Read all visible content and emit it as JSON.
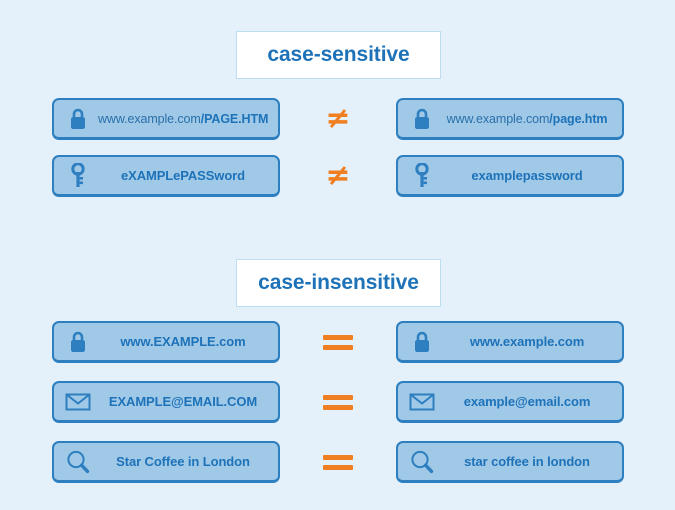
{
  "page": {
    "background_color": "#e4f1fa",
    "accent_blue": "#1d72b8",
    "box_fill": "#a0c9e8",
    "box_border": "#2e7fc0",
    "operator_orange": "#f07f22"
  },
  "sections": [
    {
      "title": "case-sensitive",
      "operator": "≠",
      "operator_name": "not-equal-sign",
      "rows": [
        {
          "operator": "≠",
          "left": {
            "icon": "lock-icon",
            "type": "url",
            "prefix": "www.example.com",
            "path": "/PAGE.HTM",
            "text": "www.example.com/PAGE.HTM"
          },
          "right": {
            "icon": "lock-icon",
            "type": "url",
            "prefix": "www.example.com",
            "path": "/page.htm",
            "text": "www.example.com/page.htm"
          }
        },
        {
          "operator": "≠",
          "left": {
            "icon": "key-icon",
            "type": "plain",
            "text": "eXAMPLePASSword"
          },
          "right": {
            "icon": "key-icon",
            "type": "plain",
            "text": "examplepassword"
          }
        }
      ]
    },
    {
      "title": "case-insensitive",
      "operator": "=",
      "operator_name": "equals-sign",
      "rows": [
        {
          "operator": "=",
          "left": {
            "icon": "lock-icon",
            "type": "plain",
            "text": "www.EXAMPLE.com"
          },
          "right": {
            "icon": "lock-icon",
            "type": "plain",
            "text": "www.example.com"
          }
        },
        {
          "operator": "=",
          "left": {
            "icon": "envelope-icon",
            "type": "plain",
            "text": "EXAMPLE@EMAIL.COM"
          },
          "right": {
            "icon": "envelope-icon",
            "type": "plain",
            "text": "example@email.com"
          }
        },
        {
          "operator": "=",
          "left": {
            "icon": "search-icon",
            "type": "plain",
            "text": "Star Coffee in London"
          },
          "right": {
            "icon": "search-icon",
            "type": "plain",
            "text": "star coffee in london"
          }
        }
      ]
    }
  ]
}
